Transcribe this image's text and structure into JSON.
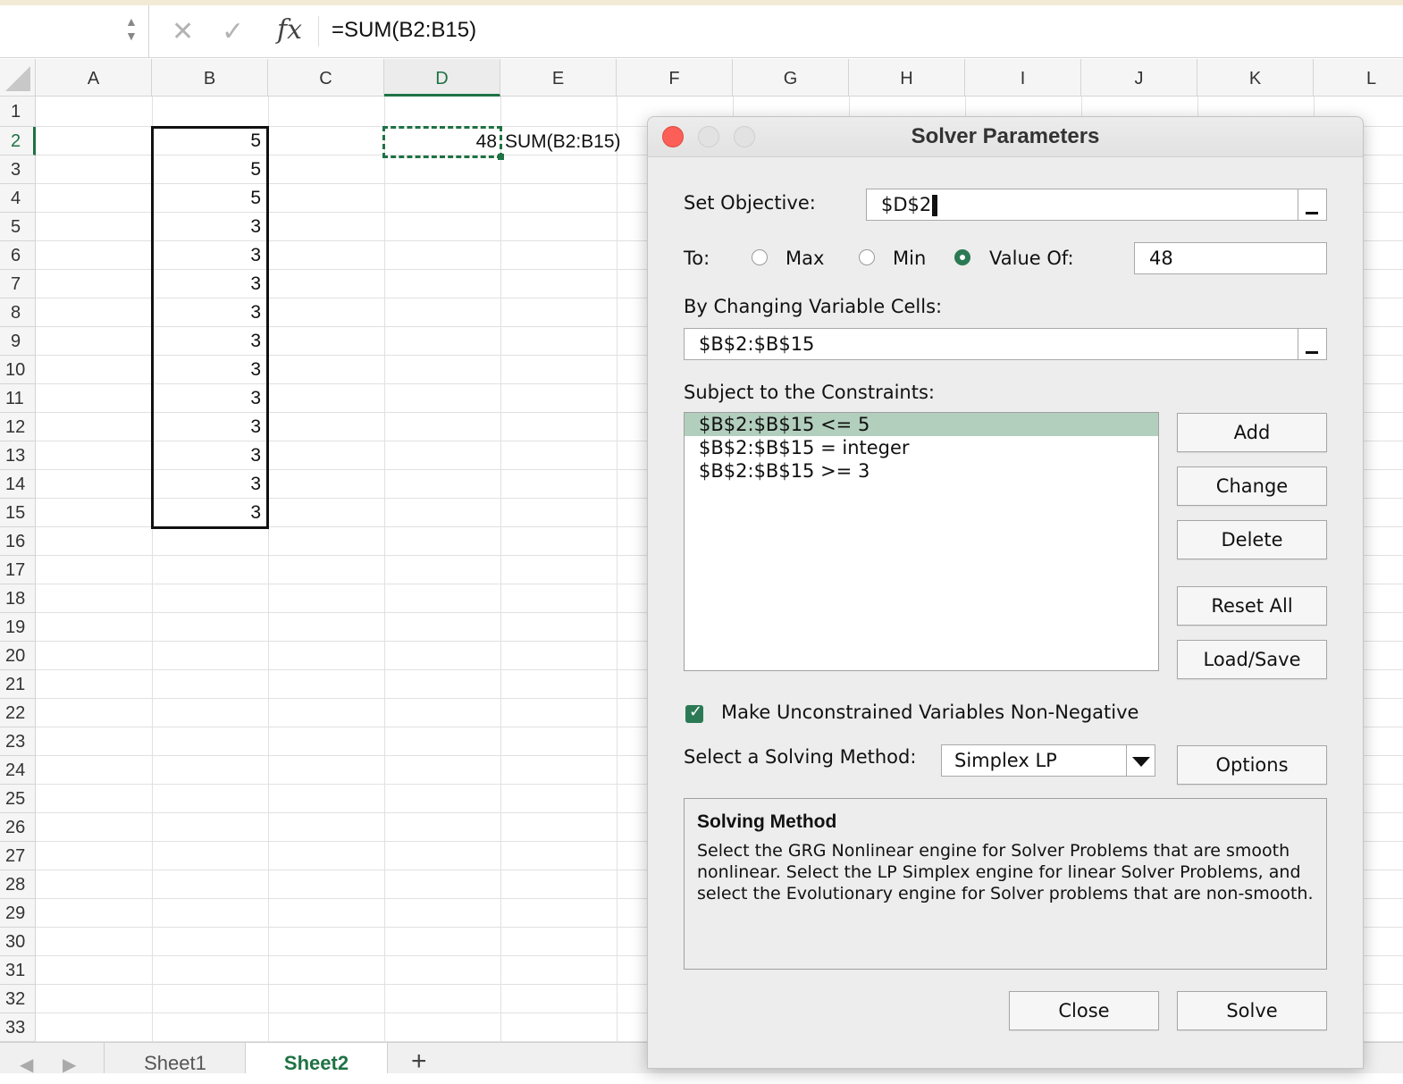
{
  "formula_bar": {
    "name_box": "",
    "formula": "=SUM(B2:B15)",
    "fx": "fx"
  },
  "sheet": {
    "columns": [
      "A",
      "B",
      "C",
      "D",
      "E",
      "F",
      "G",
      "H",
      "I",
      "J",
      "K",
      "L"
    ],
    "selected_column": "D",
    "rows": [
      "1",
      "2",
      "3",
      "4",
      "5",
      "6",
      "7",
      "8",
      "9",
      "10",
      "11",
      "12",
      "13",
      "14",
      "15",
      "16",
      "17",
      "18",
      "19",
      "20",
      "21",
      "22",
      "23",
      "24",
      "25",
      "26",
      "27",
      "28",
      "29",
      "30",
      "31",
      "32",
      "33"
    ],
    "selected_row": "2",
    "column_b_values": [
      "5",
      "5",
      "5",
      "3",
      "3",
      "3",
      "3",
      "3",
      "3",
      "3",
      "3",
      "3",
      "3",
      "3"
    ],
    "d2_value": "48",
    "e2_text": "SUM(B2:B15)"
  },
  "tabs": {
    "items": [
      "Sheet1",
      "Sheet2"
    ],
    "active": "Sheet2",
    "add_label": "+"
  },
  "dialog": {
    "title": "Solver Parameters",
    "set_objective_label": "Set Objective:",
    "set_objective_value": "$D$2",
    "to_label": "To:",
    "max_label": "Max",
    "min_label": "Min",
    "value_of_label": "Value Of:",
    "value_of_value": "48",
    "selected_option": "Value Of",
    "changing_cells_label": "By Changing Variable Cells:",
    "changing_cells_value": "$B$2:$B$15",
    "constraints_label": "Subject to the Constraints:",
    "constraints": [
      "$B$2:$B$15 <= 5",
      "$B$2:$B$15 = integer",
      "$B$2:$B$15 >= 3"
    ],
    "selected_constraint_index": 0,
    "buttons": {
      "add": "Add",
      "change": "Change",
      "delete": "Delete",
      "reset_all": "Reset All",
      "load_save": "Load/Save",
      "options": "Options",
      "close": "Close",
      "solve": "Solve"
    },
    "nonneg_label": "Make Unconstrained Variables Non-Negative",
    "nonneg_checked": true,
    "method_label": "Select a Solving Method:",
    "method_value": "Simplex LP",
    "method_box_title": "Solving Method",
    "method_box_text": "Select the GRG Nonlinear engine for Solver Problems that are smooth nonlinear. Select the LP Simplex engine for linear Solver Problems, and select the Evolutionary engine for Solver problems that are non-smooth."
  },
  "colors": {
    "excel_green": "#1f7244",
    "selected_constraint": "#b2cfbd",
    "close_light": "#fc5f57"
  }
}
